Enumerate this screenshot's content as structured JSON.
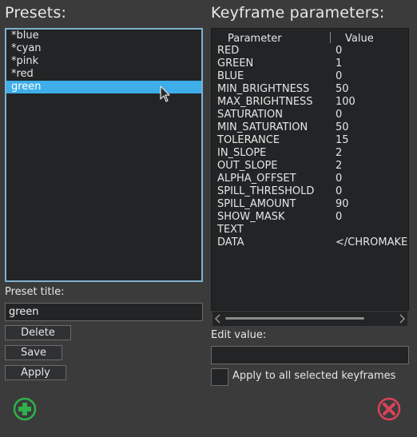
{
  "presets": {
    "heading": "Presets:",
    "items": [
      "*blue",
      "*cyan",
      "*pink",
      "*red",
      "green"
    ],
    "selected_index": 4,
    "title_label": "Preset title:",
    "title_value": "green",
    "delete_label": "Delete",
    "save_label": "Save",
    "apply_label": "Apply"
  },
  "keyframes": {
    "heading": "Keyframe parameters:",
    "col_param": "Parameter",
    "col_value": "Value",
    "rows": [
      {
        "name": "RED",
        "value": "0"
      },
      {
        "name": "GREEN",
        "value": "1"
      },
      {
        "name": "BLUE",
        "value": "0"
      },
      {
        "name": "MIN_BRIGHTNESS",
        "value": "50"
      },
      {
        "name": "MAX_BRIGHTNESS",
        "value": "100"
      },
      {
        "name": "SATURATION",
        "value": "0"
      },
      {
        "name": "MIN_SATURATION",
        "value": "50"
      },
      {
        "name": "TOLERANCE",
        "value": "15"
      },
      {
        "name": "IN_SLOPE",
        "value": "2"
      },
      {
        "name": "OUT_SLOPE",
        "value": "2"
      },
      {
        "name": "ALPHA_OFFSET",
        "value": "0"
      },
      {
        "name": "SPILL_THRESHOLD",
        "value": "0"
      },
      {
        "name": "SPILL_AMOUNT",
        "value": "90"
      },
      {
        "name": "SHOW_MASK",
        "value": "0"
      },
      {
        "name": "TEXT",
        "value": ""
      },
      {
        "name": "DATA",
        "value": "</CHROMAKE"
      }
    ],
    "edit_label": "Edit value:",
    "edit_value": "",
    "apply_all_label": "Apply to all selected keyframes",
    "apply_all_checked": false
  },
  "icons": {
    "add": "plus-circle-icon",
    "cancel": "close-circle-icon",
    "add_color": "#2fb04a",
    "cancel_color": "#d9435a"
  },
  "colors": {
    "selection": "#3daee9",
    "background": "#3b3b3b",
    "panel": "#222426"
  }
}
